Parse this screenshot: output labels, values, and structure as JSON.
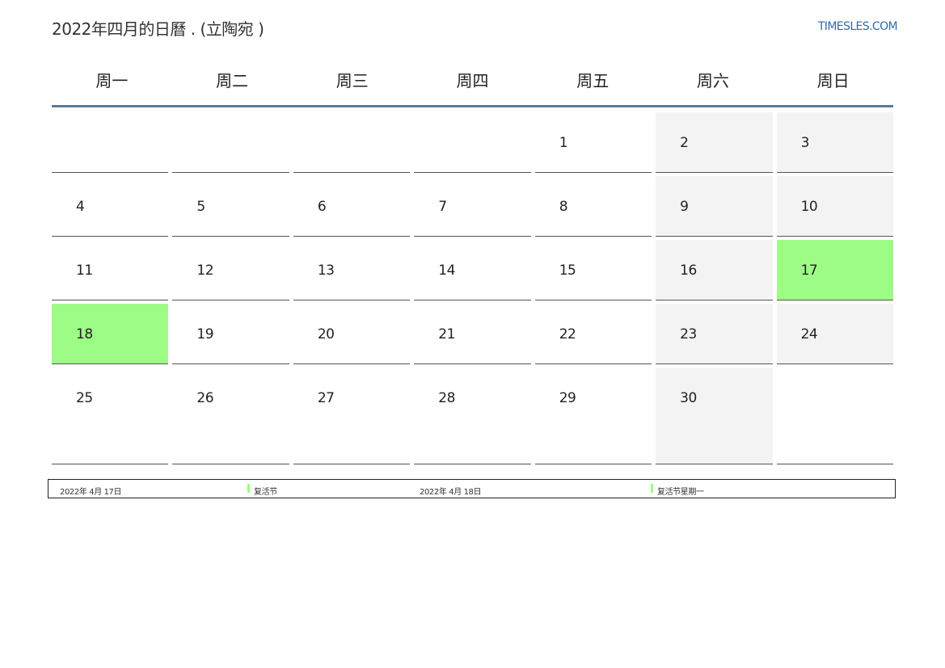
{
  "header": {
    "title": "2022年四月的日曆 . (立陶宛 )",
    "brand": "TIMESLES.COM"
  },
  "weekdays": [
    "周一",
    "周二",
    "周三",
    "周四",
    "周五",
    "周六",
    "周日"
  ],
  "colors": {
    "holiday": "#9dfc86",
    "weekend": "#f3f3f3",
    "header_rule": "#5b7a99",
    "brand": "#2b6cb0"
  },
  "calendar": {
    "cells": [
      {
        "day": "",
        "type": "normal"
      },
      {
        "day": "",
        "type": "normal"
      },
      {
        "day": "",
        "type": "normal"
      },
      {
        "day": "",
        "type": "normal"
      },
      {
        "day": "1",
        "type": "normal"
      },
      {
        "day": "2",
        "type": "weekend"
      },
      {
        "day": "3",
        "type": "weekend"
      },
      {
        "day": "4",
        "type": "normal"
      },
      {
        "day": "5",
        "type": "normal"
      },
      {
        "day": "6",
        "type": "normal"
      },
      {
        "day": "7",
        "type": "normal"
      },
      {
        "day": "8",
        "type": "normal"
      },
      {
        "day": "9",
        "type": "weekend"
      },
      {
        "day": "10",
        "type": "weekend"
      },
      {
        "day": "11",
        "type": "normal"
      },
      {
        "day": "12",
        "type": "normal"
      },
      {
        "day": "13",
        "type": "normal"
      },
      {
        "day": "14",
        "type": "normal"
      },
      {
        "day": "15",
        "type": "normal"
      },
      {
        "day": "16",
        "type": "weekend"
      },
      {
        "day": "17",
        "type": "holiday"
      },
      {
        "day": "18",
        "type": "holiday"
      },
      {
        "day": "19",
        "type": "normal"
      },
      {
        "day": "20",
        "type": "normal"
      },
      {
        "day": "21",
        "type": "normal"
      },
      {
        "day": "22",
        "type": "normal"
      },
      {
        "day": "23",
        "type": "weekend"
      },
      {
        "day": "24",
        "type": "weekend"
      },
      {
        "day": "25",
        "type": "normal"
      },
      {
        "day": "26",
        "type": "normal"
      },
      {
        "day": "27",
        "type": "normal"
      },
      {
        "day": "28",
        "type": "normal"
      },
      {
        "day": "29",
        "type": "normal"
      },
      {
        "day": "30",
        "type": "weekend"
      },
      {
        "day": "",
        "type": "normal"
      }
    ]
  },
  "holidays": [
    {
      "date": "2022年 4月 17日",
      "name": "复活节"
    },
    {
      "date": "2022年 4月 18日",
      "name": "复活节星期一"
    }
  ]
}
